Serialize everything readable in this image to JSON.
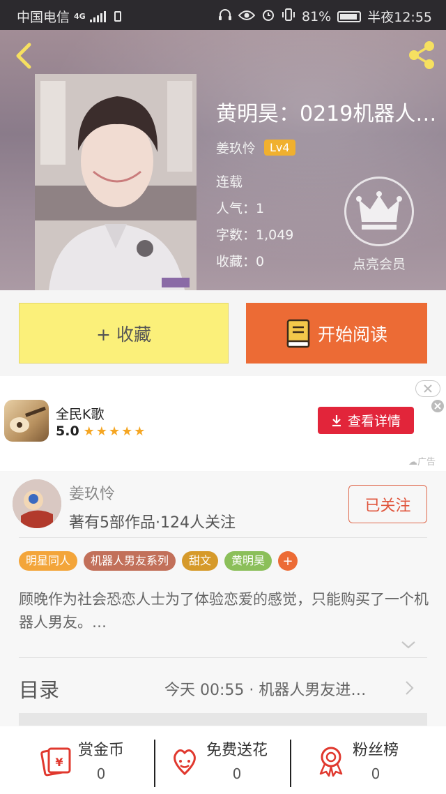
{
  "status_bar": {
    "carrier": "中国电信",
    "network": "4G",
    "battery": "81%",
    "time": "半夜12:55"
  },
  "book": {
    "title": "黄明昊：0219机器人…",
    "author": "姜玖怜",
    "level": "Lv4",
    "status": "连载",
    "popularity": "人气：1",
    "word_count": "字数：1,049",
    "favorites": "收藏：0"
  },
  "vip": {
    "label": "点亮会员"
  },
  "actions": {
    "favorite_label": "+ 收藏",
    "read_label": "开始阅读"
  },
  "ad": {
    "app_name": "全民K歌",
    "rating": "5.0",
    "stars": "★★★★★",
    "button_label": "查看详情",
    "ad_tag": "广告"
  },
  "author_card": {
    "name": "姜玖怜",
    "stats": "著有5部作品·124人关注",
    "follow_label": "已关注"
  },
  "tags": [
    {
      "label": "明星同人",
      "color": "#f3a53a"
    },
    {
      "label": "机器人男友系列",
      "color": "#c2705a"
    },
    {
      "label": "甜文",
      "color": "#d69a2a"
    },
    {
      "label": "黄明昊",
      "color": "#8bbf5a"
    }
  ],
  "tag_plus": "+",
  "description": "顾晚作为社会恐恋人士为了体验恋爱的感觉，只能购买了一个机器人男友。…",
  "toc": {
    "label": "目录",
    "latest": "今天 00:55 · 机器人男友进…"
  },
  "bottom_bar": [
    {
      "label": "赏金币",
      "value": "0",
      "icon": "coin-envelope-icon"
    },
    {
      "label": "免费送花",
      "value": "0",
      "icon": "flower-icon"
    },
    {
      "label": "粉丝榜",
      "value": "0",
      "icon": "ribbon-medal-icon"
    }
  ],
  "colors": {
    "accent_orange": "#ec6b35",
    "favorite_yellow": "#fbf07a",
    "ad_red": "#e2253a",
    "level_badge": "#f0b02e"
  }
}
